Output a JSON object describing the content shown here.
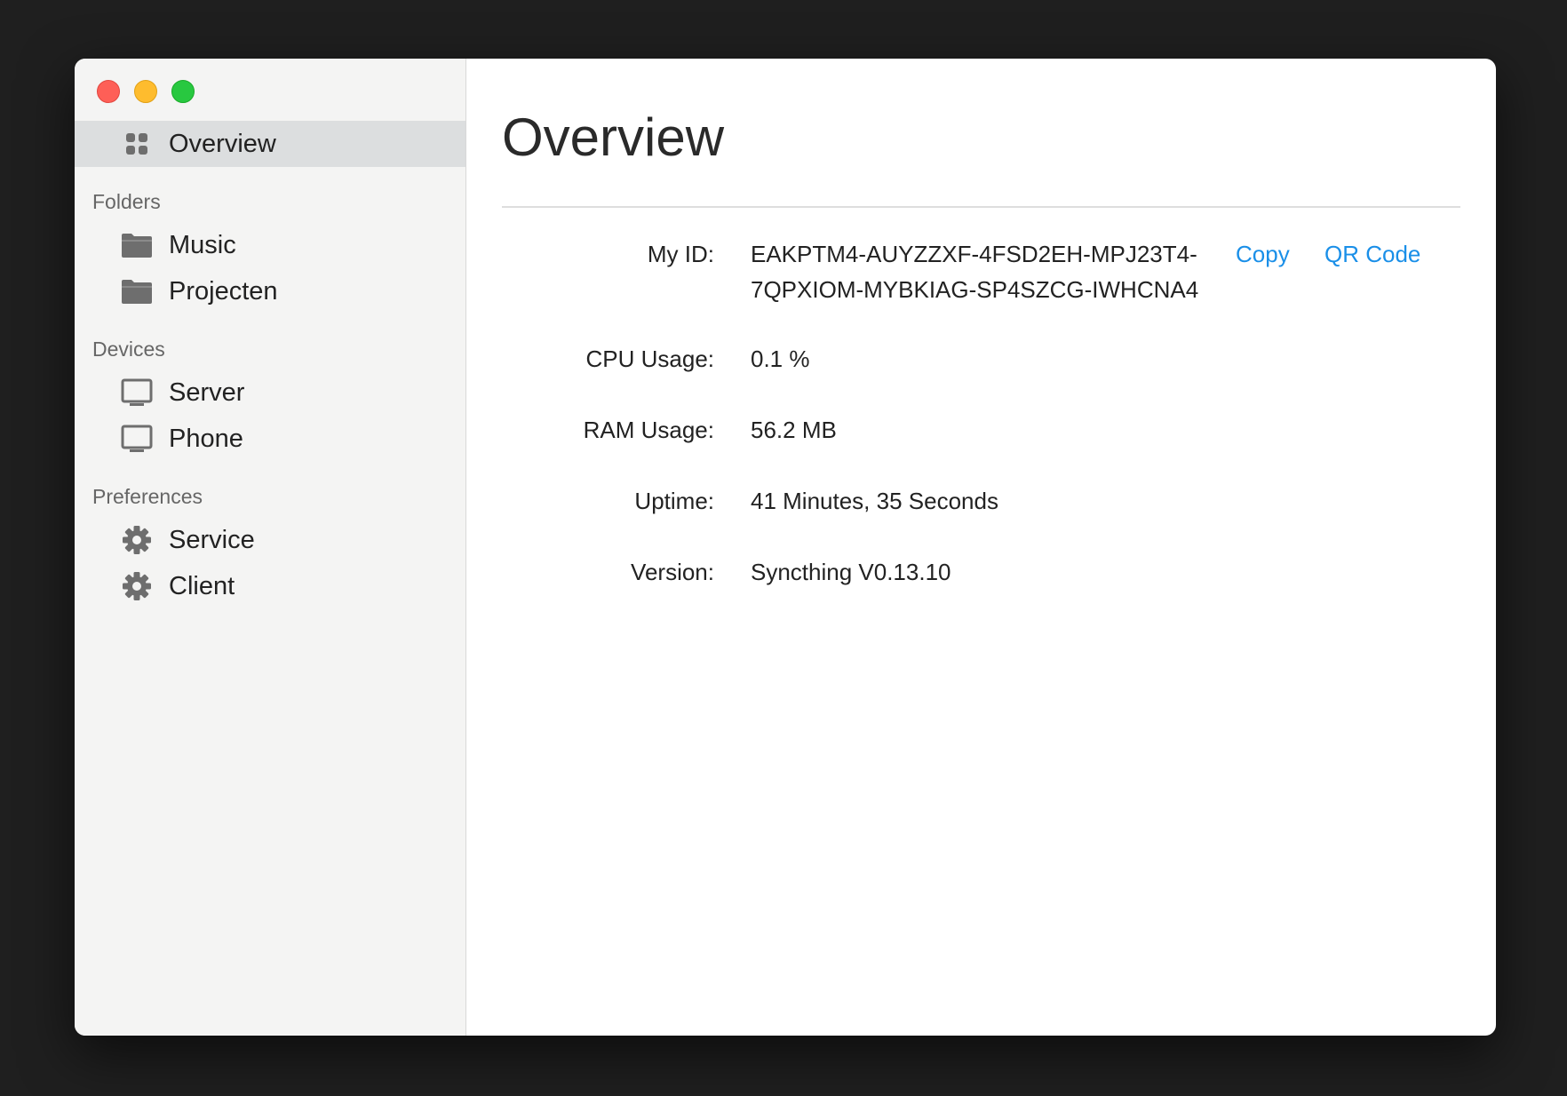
{
  "sidebar": {
    "overview": {
      "label": "Overview",
      "icon": "grid-icon"
    },
    "sections": {
      "folders": {
        "label": "Folders",
        "items": [
          {
            "label": "Music",
            "icon": "folder-icon"
          },
          {
            "label": "Projecten",
            "icon": "folder-icon"
          }
        ]
      },
      "devices": {
        "label": "Devices",
        "items": [
          {
            "label": "Server",
            "icon": "monitor-icon"
          },
          {
            "label": "Phone",
            "icon": "monitor-icon"
          }
        ]
      },
      "preferences": {
        "label": "Preferences",
        "items": [
          {
            "label": "Service",
            "icon": "gear-icon"
          },
          {
            "label": "Client",
            "icon": "gear-icon"
          }
        ]
      }
    }
  },
  "main": {
    "title": "Overview",
    "rows": [
      {
        "label": "My ID:",
        "value_line1": "EAKPTM4-AUYZZXF-4FSD2EH-MPJ23T4-",
        "value_line2": "7QPXIOM-MYBKIAG-SP4SZCG-IWHCNA4"
      },
      {
        "label": "CPU Usage:",
        "value": "0.1 %"
      },
      {
        "label": "RAM Usage:",
        "value": "56.2 MB"
      },
      {
        "label": "Uptime:",
        "value": "41 Minutes, 35 Seconds"
      },
      {
        "label": "Version:",
        "value": "Syncthing V0.13.10"
      }
    ],
    "actions": {
      "copy": "Copy",
      "qr": "QR Code"
    }
  },
  "colors": {
    "accent": "#1a8fe8",
    "sidebar_bg": "#f4f4f3",
    "selected_bg": "#dcdedf",
    "close": "#fe5f57",
    "minimize": "#febc2e",
    "maximize": "#28c840"
  }
}
